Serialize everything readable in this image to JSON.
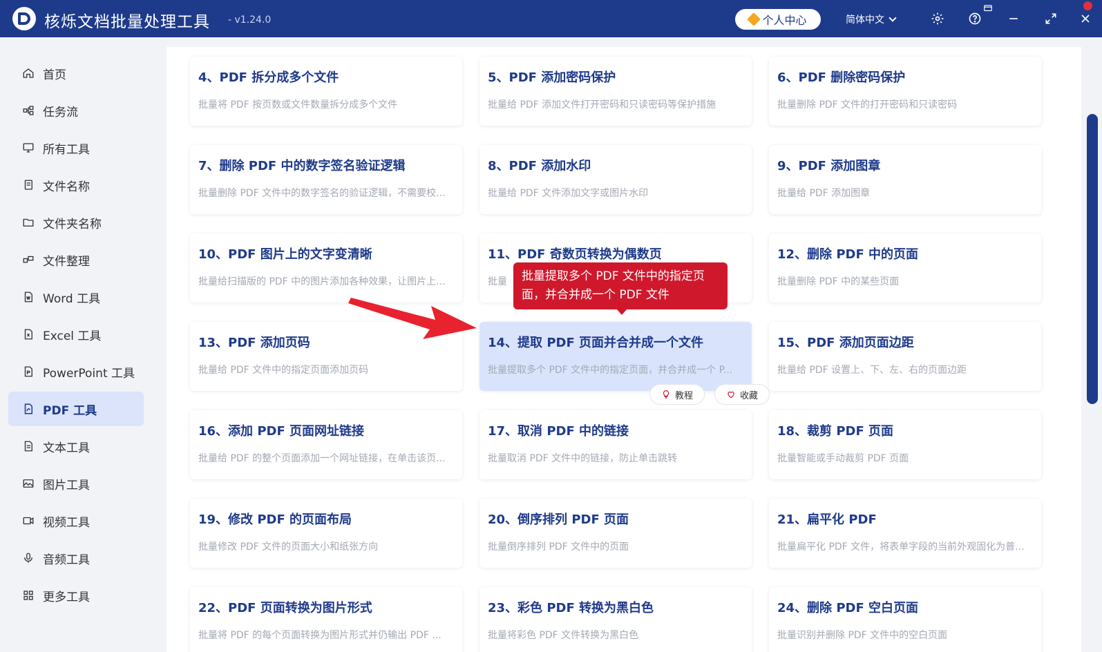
{
  "app": {
    "title": "核烁文档批量处理工具",
    "version": "- v1.24.0",
    "user_center": "个人中心",
    "language": "简体中文"
  },
  "sidebar": {
    "items": [
      {
        "label": "首页",
        "icon": "home-icon"
      },
      {
        "label": "任务流",
        "icon": "workflow-icon"
      },
      {
        "label": "所有工具",
        "icon": "monitor-icon"
      },
      {
        "label": "文件名称",
        "icon": "file-copy-icon"
      },
      {
        "label": "文件夹名称",
        "icon": "folder-icon"
      },
      {
        "label": "文件整理",
        "icon": "organize-icon"
      },
      {
        "label": "Word 工具",
        "icon": "word-icon"
      },
      {
        "label": "Excel 工具",
        "icon": "excel-icon"
      },
      {
        "label": "PowerPoint 工具",
        "icon": "ppt-icon"
      },
      {
        "label": "PDF 工具",
        "icon": "pdf-icon",
        "active": true
      },
      {
        "label": "文本工具",
        "icon": "text-icon"
      },
      {
        "label": "图片工具",
        "icon": "image-icon"
      },
      {
        "label": "视频工具",
        "icon": "video-icon"
      },
      {
        "label": "音频工具",
        "icon": "mic-icon"
      },
      {
        "label": "更多工具",
        "icon": "grid-icon"
      }
    ]
  },
  "cards": [
    {
      "title": "4、PDF 拆分成多个文件",
      "desc": "批量将 PDF 按页数或文件数量拆分成多个文件"
    },
    {
      "title": "5、PDF 添加密码保护",
      "desc": "批量给 PDF 添加文件打开密码和只读密码等保护措施"
    },
    {
      "title": "6、PDF 删除密码保护",
      "desc": "批量删除 PDF 文件的打开密码和只读密码"
    },
    {
      "title": "7、删除 PDF 中的数字签名验证逻辑",
      "desc": "批量删除 PDF 文件中的数字签名的验证逻辑，不需要校..."
    },
    {
      "title": "8、PDF 添加水印",
      "desc": "批量给 PDF 文件添加文字或图片水印"
    },
    {
      "title": "9、PDF 添加图章",
      "desc": "批量给 PDF 添加图章"
    },
    {
      "title": "10、PDF 图片上的文字变清晰",
      "desc": "批量给扫描版的 PDF 中的图片添加各种效果，让图片上..."
    },
    {
      "title": "11、PDF 奇数页转换为偶数页",
      "desc": "批量"
    },
    {
      "title": "12、删除 PDF 中的页面",
      "desc": "批量删除 PDF 中的某些页面"
    },
    {
      "title": "13、PDF 添加页码",
      "desc": "批量给 PDF 文件中的指定页面添加页码"
    },
    {
      "title": "14、提取 PDF 页面并合并成一个文件",
      "desc": "批量提取多个 PDF 文件中的指定页面，并合并成一个 P...",
      "hover": true
    },
    {
      "title": "15、PDF 添加页面边距",
      "desc": "批量给 PDF 设置上、下、左、右的页面边距"
    },
    {
      "title": "16、添加 PDF 页面网址链接",
      "desc": "批量给 PDF 的整个页面添加一个网址链接，在单击该页..."
    },
    {
      "title": "17、取消 PDF 中的链接",
      "desc": "批量取消 PDF 文件中的链接，防止单击跳转"
    },
    {
      "title": "18、裁剪 PDF 页面",
      "desc": "批量智能或手动裁剪 PDF 页面"
    },
    {
      "title": "19、修改 PDF 的页面布局",
      "desc": "批量修改 PDF 文件的页面大小和纸张方向"
    },
    {
      "title": "20、倒序排列 PDF 页面",
      "desc": "批量倒序排列 PDF 文件中的页面"
    },
    {
      "title": "21、扁平化 PDF",
      "desc": "批量扁平化 PDF 文件，将表单字段的当前外观固化为普..."
    },
    {
      "title": "22、PDF 页面转换为图片形式",
      "desc": "批量将 PDF 的每个页面转换为图片形式并仍输出 PDF ..."
    },
    {
      "title": "23、彩色 PDF 转换为黑白色",
      "desc": "批量将彩色 PDF 文件转换为黑白色"
    },
    {
      "title": "24、删除 PDF 空白页面",
      "desc": "批量识别并删除 PDF 文件中的空白页面"
    }
  ],
  "hover_actions": {
    "tutorial": "教程",
    "favorite": "收藏"
  },
  "tooltip": {
    "line1": "批量提取多个 PDF 文件中的指定页",
    "line2": "面，并合并成一个 PDF 文件"
  },
  "colors": {
    "brand": "#1e3a8a",
    "tooltip": "#d0182c",
    "hover_card": "#d9e4fc"
  }
}
